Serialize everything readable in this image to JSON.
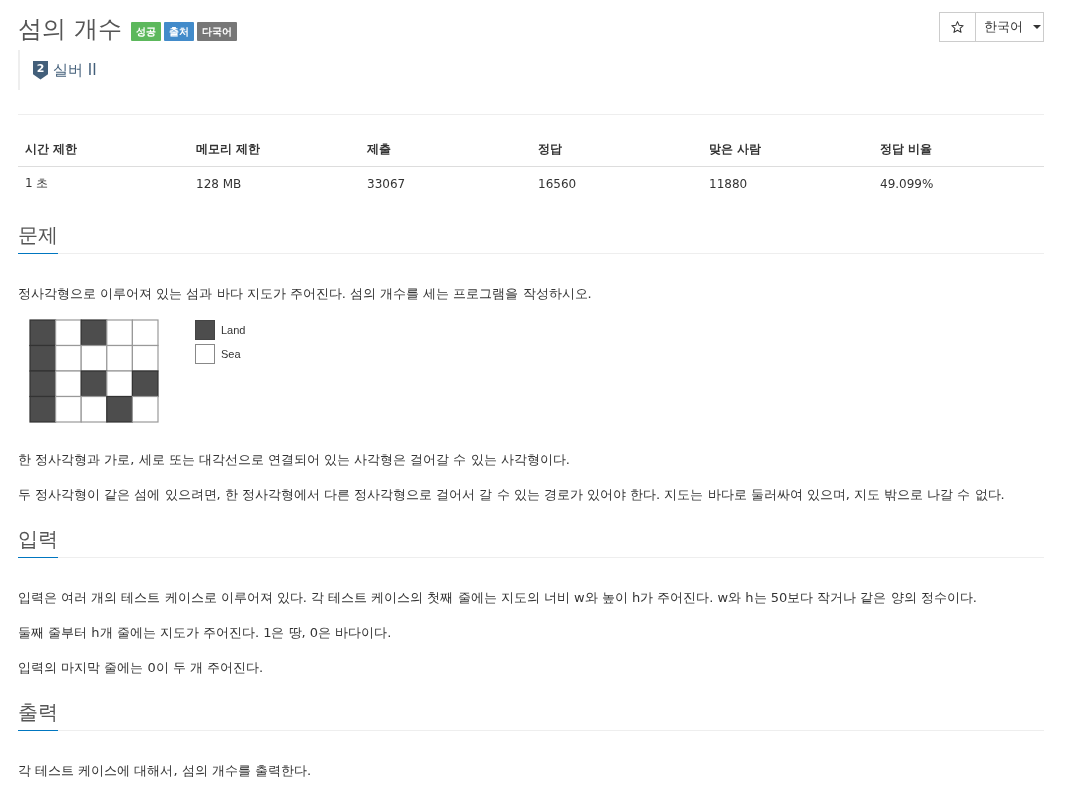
{
  "header": {
    "title": "섬의 개수",
    "labels": [
      {
        "text": "성공",
        "color": "#5cb85c"
      },
      {
        "text": "출처",
        "color": "#428bca"
      },
      {
        "text": "다국어",
        "color": "#777777"
      }
    ],
    "tier": {
      "number": "2",
      "name": "실버 II"
    }
  },
  "toolbar": {
    "starred": false,
    "language": "한국어"
  },
  "info_table": {
    "columns": [
      "시간 제한",
      "메모리 제한",
      "제출",
      "정답",
      "맞은 사람",
      "정답 비율"
    ],
    "rows": [
      [
        "1 초",
        "128 MB",
        "33067",
        "16560",
        "11880",
        "49.099%"
      ]
    ]
  },
  "sections": [
    {
      "heading": "문제",
      "blocks": [
        {
          "kind": "paragraph",
          "text": "정사각형으로 이루어져 있는 섬과 바다 지도가 주어진다. 섬의 개수를 세는 프로그램을 작성하시오."
        },
        {
          "kind": "figure",
          "land_map": [
            [
              true,
              false,
              true,
              false,
              false
            ],
            [
              true,
              false,
              false,
              false,
              false
            ],
            [
              true,
              false,
              true,
              false,
              true
            ],
            [
              true,
              false,
              false,
              true,
              false
            ]
          ],
          "legend": [
            {
              "label": "Land",
              "land": true
            },
            {
              "label": "Sea",
              "land": false
            }
          ]
        },
        {
          "kind": "paragraph",
          "text": "한 정사각형과 가로, 세로 또는 대각선으로 연결되어 있는 사각형은 걸어갈 수 있는 사각형이다."
        },
        {
          "kind": "paragraph",
          "text": "두 정사각형이 같은 섬에 있으려면, 한 정사각형에서 다른 정사각형으로 걸어서 갈 수 있는 경로가 있어야 한다. 지도는 바다로 둘러싸여 있으며, 지도 밖으로 나갈 수 없다."
        }
      ]
    },
    {
      "heading": "입력",
      "blocks": [
        {
          "kind": "paragraph",
          "text": "입력은 여러 개의 테스트 케이스로 이루어져 있다. 각 테스트 케이스의 첫째 줄에는 지도의 너비 w와 높이 h가 주어진다. w와 h는 50보다 작거나 같은 양의 정수이다."
        },
        {
          "kind": "paragraph",
          "text": "둘째 줄부터 h개 줄에는 지도가 주어진다. 1은 땅, 0은 바다이다."
        },
        {
          "kind": "paragraph",
          "text": "입력의 마지막 줄에는 0이 두 개 주어진다."
        }
      ]
    },
    {
      "heading": "출력",
      "blocks": [
        {
          "kind": "paragraph",
          "text": "각 테스트 케이스에 대해서, 섬의 개수를 출력한다."
        }
      ]
    }
  ]
}
